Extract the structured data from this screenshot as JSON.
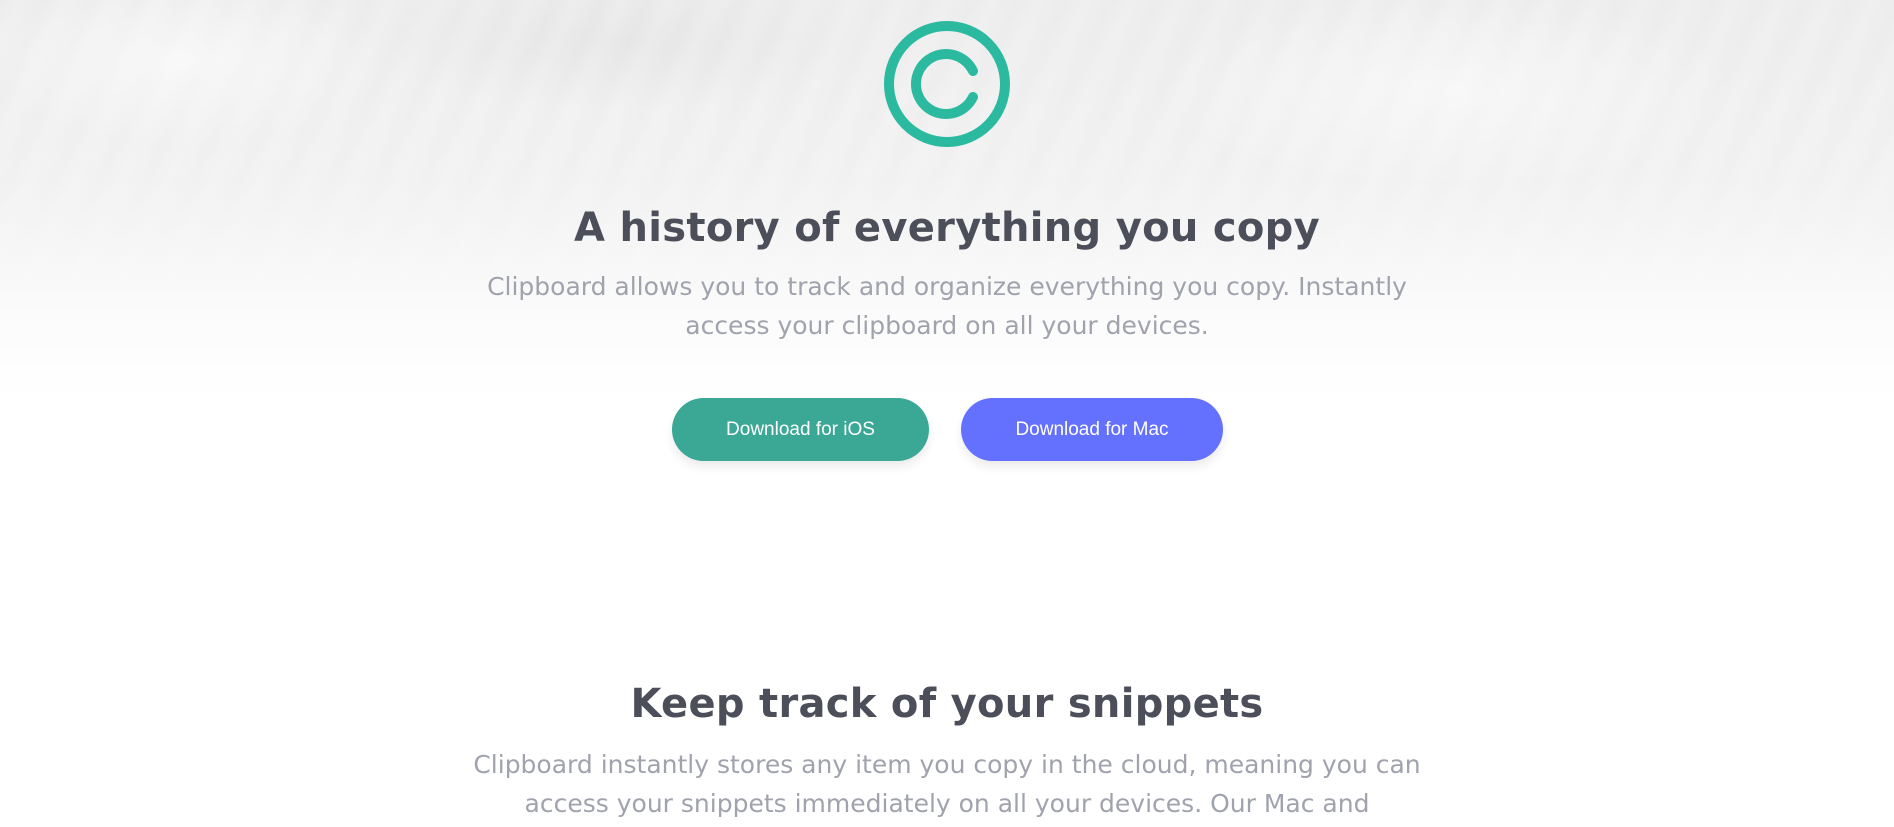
{
  "hero": {
    "logo_icon": "copyright-c-logo-icon",
    "logo_color": "#2bb9a0",
    "title": "A history of everything you copy",
    "description": "Clipboard allows you to track and organize everything you copy. Instantly access your clipboard on all your devices.",
    "buttons": {
      "ios_label": "Download for iOS",
      "ios_color": "#3aa895",
      "mac_label": "Download for Mac",
      "mac_color": "#6470fe"
    }
  },
  "snippets_section": {
    "title": "Keep track of your snippets",
    "description": "Clipboard instantly stores any item you copy in the cloud, meaning you can access your snippets immediately on all your devices. Our Mac and"
  }
}
